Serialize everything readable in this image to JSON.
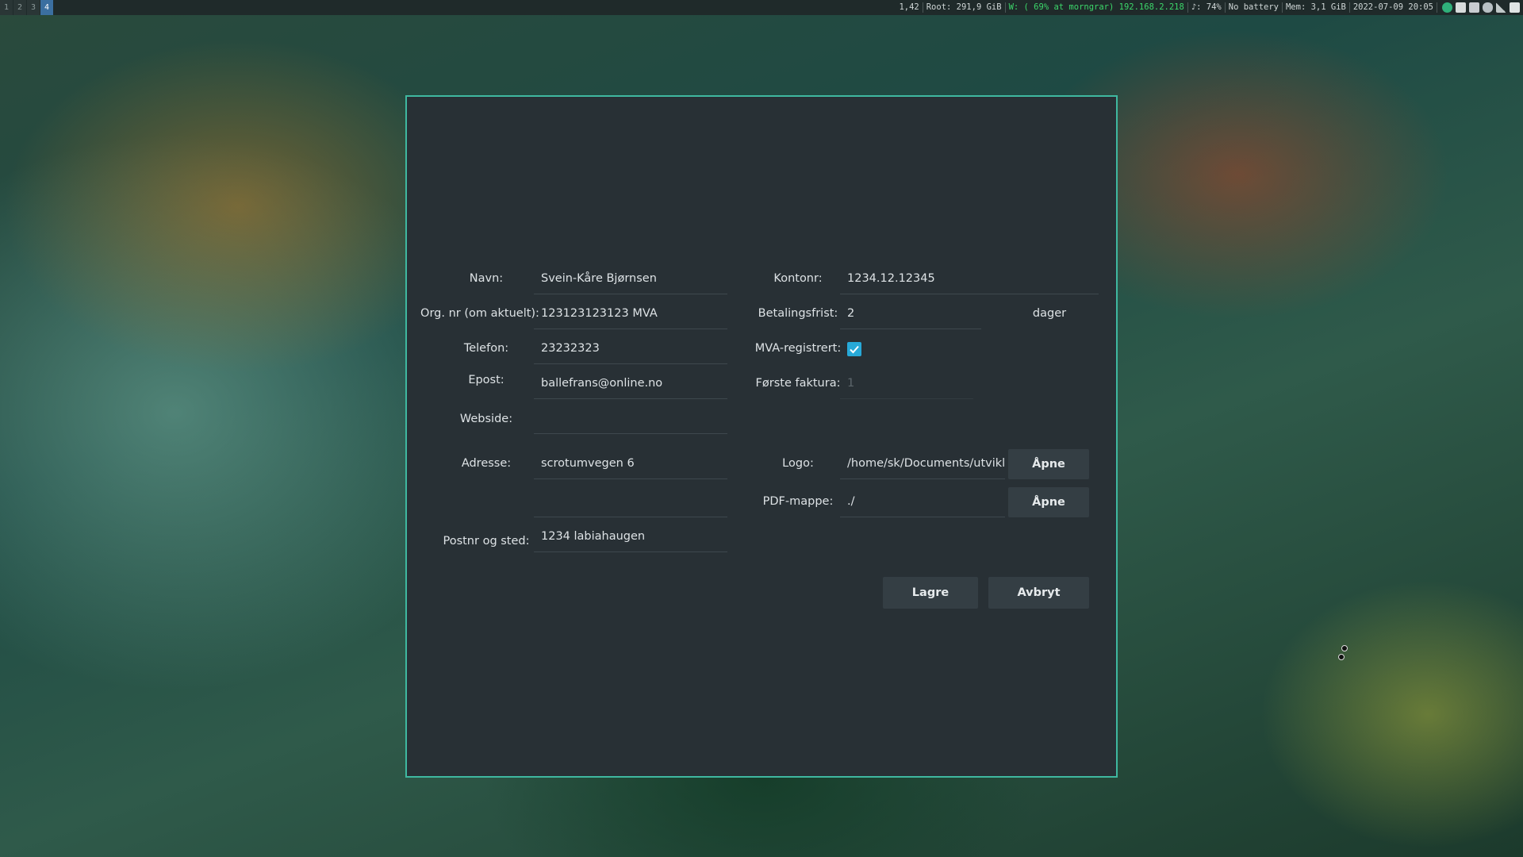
{
  "statusbar": {
    "workspaces": [
      "1",
      "2",
      "3",
      "4"
    ],
    "active_workspace": "4",
    "load": "1,42",
    "disk": "Root: 291,9 GiB",
    "wifi": "W: ( 69% at morngrar) 192.168.2.218",
    "volume": "♪: 74%",
    "battery": "No battery",
    "memory": "Mem: 3,1 GiB",
    "datetime": "2022-07-09 20:05",
    "tray_icons": [
      "globe-icon",
      "discord-icon",
      "dropbox-icon",
      "cloud-icon",
      "network-icon",
      "update-icon"
    ]
  },
  "form": {
    "navn_label": "Navn:",
    "navn_value": "Svein-Kåre Bjørnsen",
    "orgnr_label": "Org. nr (om aktuelt):",
    "orgnr_value": "123123123123 MVA",
    "telefon_label": "Telefon:",
    "telefon_value": "23232323",
    "epost_label": "Epost:",
    "epost_value": "ballefrans@online.no",
    "webside_label": "Webside:",
    "webside_value": "",
    "adresse_label": "Adresse:",
    "adresse_value": "scrotumvegen 6",
    "adresse2_value": "",
    "postnr_label": "Postnr og sted:",
    "postnr_value": "1234 labiahaugen",
    "kontonr_label": "Kontonr:",
    "kontonr_value": "1234.12.12345",
    "betalingsfrist_label": "Betalingsfrist:",
    "betalingsfrist_value": "2",
    "betalingsfrist_unit": "dager",
    "mva_label": "MVA-registrert:",
    "mva_checked": true,
    "forste_faktura_label": "Første faktura:",
    "forste_faktura_value": "1",
    "logo_label": "Logo:",
    "logo_value": "/home/sk/Documents/utviklir",
    "logo_button": "Åpne",
    "pdf_label": "PDF-mappe:",
    "pdf_value": "./",
    "pdf_button": "Åpne",
    "save_button": "Lagre",
    "cancel_button": "Avbryt"
  },
  "colors": {
    "dialog_bg": "#283035",
    "dialog_border": "#3fb8a0",
    "checkbox": "#27a9d8",
    "wifi_text": "#3cd66a",
    "active_workspace": "#3b6fa0"
  }
}
